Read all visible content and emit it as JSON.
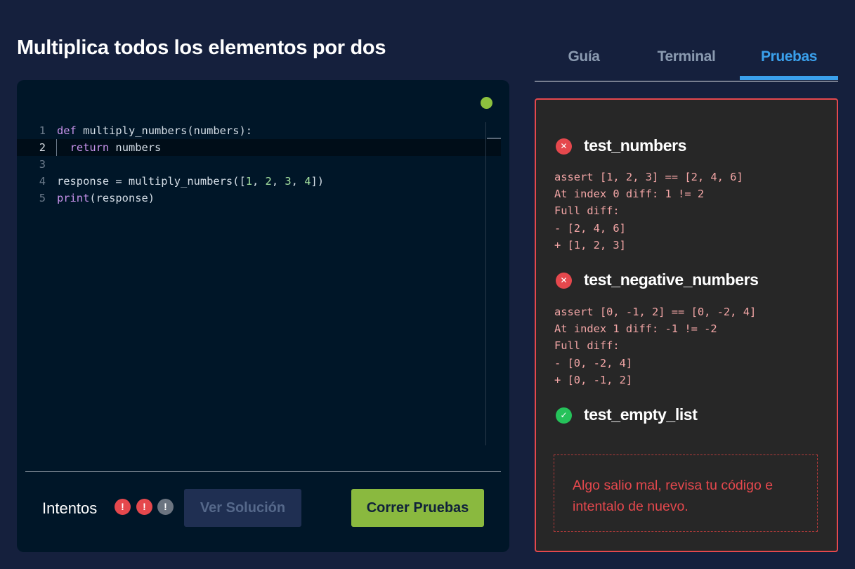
{
  "title": "Multiplica todos los elementos por dos",
  "editor": {
    "lines": [
      {
        "n": "1",
        "tokens": [
          {
            "t": "def",
            "c": "kw"
          },
          {
            "t": " multiply_numbers(numbers):",
            "c": ""
          }
        ]
      },
      {
        "n": "2",
        "tokens": [
          {
            "t": "  ",
            "c": ""
          },
          {
            "t": "return",
            "c": "kw"
          },
          {
            "t": " numbers",
            "c": ""
          }
        ],
        "active": true
      },
      {
        "n": "3",
        "tokens": []
      },
      {
        "n": "4",
        "tokens": [
          {
            "t": "response = multiply_numbers([",
            "c": ""
          },
          {
            "t": "1",
            "c": "num"
          },
          {
            "t": ", ",
            "c": ""
          },
          {
            "t": "2",
            "c": "num"
          },
          {
            "t": ", ",
            "c": ""
          },
          {
            "t": "3",
            "c": "num"
          },
          {
            "t": ", ",
            "c": ""
          },
          {
            "t": "4",
            "c": "num"
          },
          {
            "t": "])",
            "c": ""
          }
        ]
      },
      {
        "n": "5",
        "tokens": [
          {
            "t": "print",
            "c": "kw"
          },
          {
            "t": "(response)",
            "c": ""
          }
        ]
      }
    ],
    "status_color": "#8dc13e"
  },
  "footer": {
    "attempts_label": "Intentos",
    "attempts": [
      {
        "symbol": "!",
        "state": "used"
      },
      {
        "symbol": "!",
        "state": "used"
      },
      {
        "symbol": "!",
        "state": "free"
      }
    ],
    "solution_label": "Ver Solución",
    "run_label": "Correr Pruebas"
  },
  "tabs": [
    {
      "label": "Guía",
      "active": false
    },
    {
      "label": "Terminal",
      "active": false
    },
    {
      "label": "Pruebas",
      "active": true
    }
  ],
  "tests": [
    {
      "name": "test_numbers",
      "status": "fail",
      "icon": "close-icon",
      "symbol": "✕",
      "output": "assert [1, 2, 3] == [2, 4, 6]\nAt index 0 diff: 1 != 2\nFull diff:\n- [2, 4, 6]\n+ [1, 2, 3]"
    },
    {
      "name": "test_negative_numbers",
      "status": "fail",
      "icon": "close-icon",
      "symbol": "✕",
      "output": "assert [0, -1, 2] == [0, -2, 4]\nAt index 1 diff: -1 != -2\nFull diff:\n- [0, -2, 4]\n+ [0, -1, 2]"
    },
    {
      "name": "test_empty_list",
      "status": "pass",
      "icon": "check-icon",
      "symbol": "✓",
      "output": ""
    }
  ],
  "error_message": "Algo salio mal, revisa tu código e intentalo de nuevo.",
  "colors": {
    "background": "#15203d",
    "accent_blue": "#3aa0ec",
    "error_red": "#e5484d",
    "pass_green": "#25c25a",
    "run_button": "#8ab93f"
  }
}
